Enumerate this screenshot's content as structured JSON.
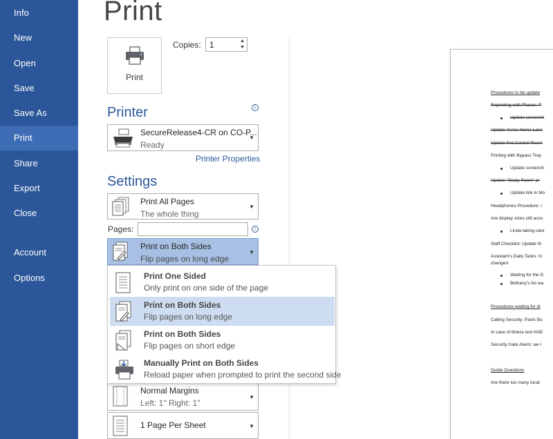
{
  "sidebar": {
    "items": [
      {
        "label": "Info"
      },
      {
        "label": "New"
      },
      {
        "label": "Open"
      },
      {
        "label": "Save"
      },
      {
        "label": "Save As"
      },
      {
        "label": "Print"
      },
      {
        "label": "Share"
      },
      {
        "label": "Export"
      },
      {
        "label": "Close"
      },
      {
        "label": "Account"
      },
      {
        "label": "Options"
      }
    ],
    "active": "Print",
    "bg_color": "#2b579a",
    "active_color": "#3e6db5"
  },
  "title": "Print",
  "print_button": {
    "label": "Print",
    "icon": "printer-icon"
  },
  "copies": {
    "label": "Copies:",
    "value": "1"
  },
  "printer": {
    "heading": "Printer",
    "name": "SecureRelease4-CR on CO-P...",
    "status": "Ready",
    "properties_link": "Printer Properties"
  },
  "settings": {
    "heading": "Settings",
    "pages_range": {
      "main": "Print All Pages",
      "sub": "The whole thing"
    },
    "pages_label": "Pages:",
    "pages_value": "",
    "sides": {
      "main": "Print on Both Sides",
      "sub": "Flip pages on long edge"
    },
    "margins": {
      "main": "Normal Margins",
      "sub": "Left: 1\"   Right: 1\""
    },
    "per_sheet": {
      "main": "1 Page Per Sheet"
    }
  },
  "sides_menu": {
    "options": [
      {
        "title": "Print One Sided",
        "desc": "Only print on one side of the page"
      },
      {
        "title": "Print on Both Sides",
        "desc": "Flip pages on long edge"
      },
      {
        "title": "Print on Both Sides",
        "desc": "Flip pages on short edge"
      },
      {
        "title": "Manually Print on Both Sides",
        "desc": "Reload paper when prompted to print the second side"
      }
    ],
    "selected_index": 1
  },
  "preview": {
    "lines": [
      "Procedures to be update",
      "Reprinting with Pharos: P",
      "Update screensh",
      "Update Xerox Home Lanc",
      "Update Net Control Room",
      "Printing with Bypass Tray",
      "Update screensh",
      "Update \"Study Room\" pr",
      "Update link in Mo",
      "Headphones Procedure: r",
      "Are display sizes still accu",
      "Linda taking care",
      "Staff Checklist: Update th",
      "Assistant's Daily Tasks: In",
      "changed",
      "Waiting for the D",
      "Bethany's list wa",
      "Procedures waiting for di",
      "Calling Security: Panic Bu",
      "In case of illness text AND",
      "Security Gate Alarm: we l",
      "Guide Questions",
      "Are there too many locat"
    ]
  }
}
